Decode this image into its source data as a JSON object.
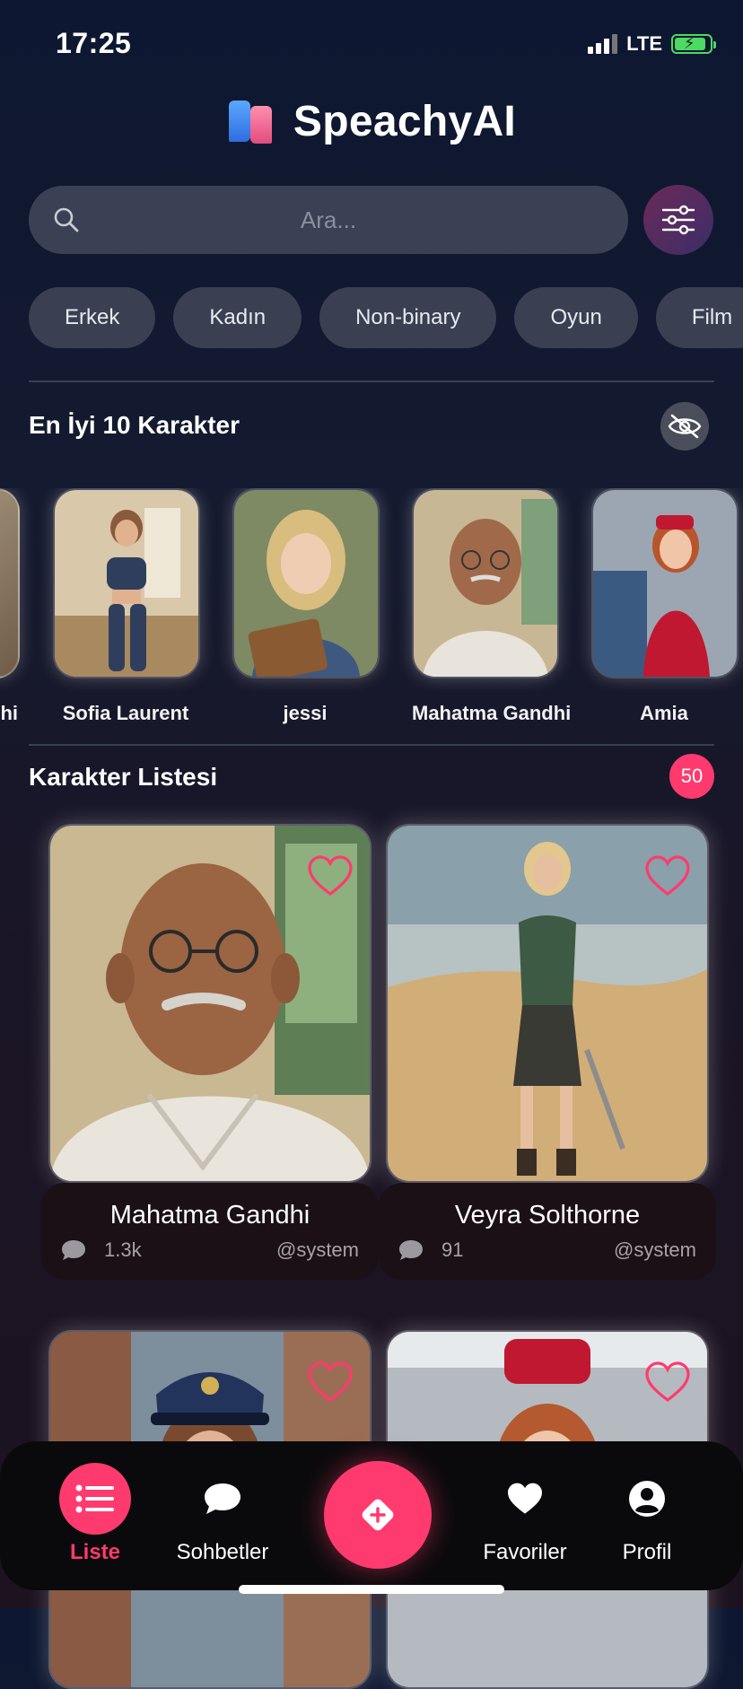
{
  "status": {
    "time": "17:25",
    "network": "LTE"
  },
  "app": {
    "title": "SpeachyAI"
  },
  "search": {
    "placeholder": "Ara..."
  },
  "categories": [
    "Erkek",
    "Kadın",
    "Non-binary",
    "Oyun",
    "Film"
  ],
  "top10": {
    "title": "En İyi 10 Karakter",
    "items": [
      {
        "name": "hi"
      },
      {
        "name": "Sofia Laurent"
      },
      {
        "name": "jessi"
      },
      {
        "name": "Mahatma Gandhi"
      },
      {
        "name": "Amia"
      }
    ]
  },
  "character_list": {
    "title": "Karakter Listesi",
    "count": "50",
    "cards": [
      {
        "name": "Mahatma Gandhi",
        "chats": "1.3k",
        "author": "@system"
      },
      {
        "name": "Veyra Solthorne",
        "chats": "91",
        "author": "@system"
      }
    ]
  },
  "nav": {
    "list": "Liste",
    "chats": "Sohbetler",
    "favorites": "Favoriler",
    "profile": "Profil"
  },
  "colors": {
    "accent": "#ff3a6e",
    "chip_bg": "#3a4052",
    "battery": "#4cd964"
  }
}
